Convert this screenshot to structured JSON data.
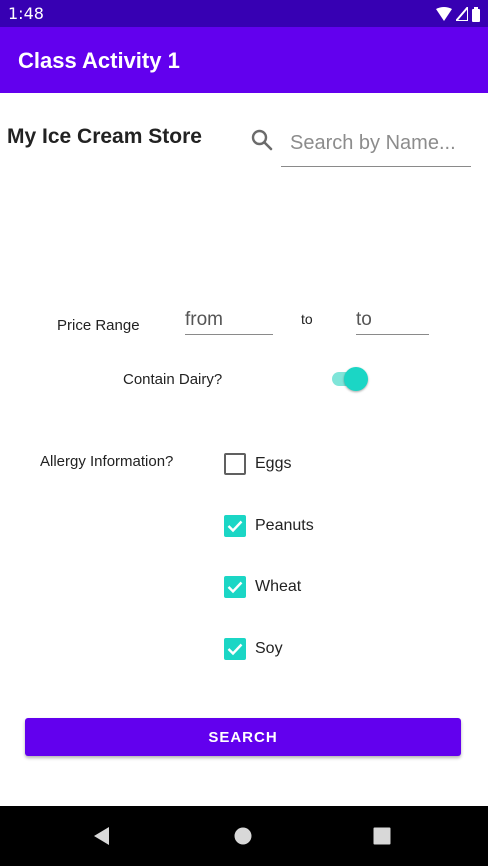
{
  "status_bar": {
    "time": "1:48",
    "icons": [
      "wifi-icon",
      "signal-icon",
      "battery-icon"
    ]
  },
  "app_bar": {
    "title": "Class Activity 1"
  },
  "header": {
    "store_title": "My Ice Cream Store",
    "search_placeholder": "Search by Name...",
    "search_icon": "search-icon"
  },
  "filters": {
    "price_range_label": "Price Range",
    "from_placeholder": "from",
    "to_label": "to",
    "to_placeholder": "to",
    "dairy_label": "Contain Dairy?",
    "dairy_on": true,
    "allergy_label": "Allergy Information?",
    "allergies": [
      {
        "label": "Eggs",
        "checked": false
      },
      {
        "label": "Peanuts",
        "checked": true
      },
      {
        "label": "Wheat",
        "checked": true
      },
      {
        "label": "Soy",
        "checked": true
      }
    ]
  },
  "search_button": {
    "label": "SEARCH"
  },
  "nav": {
    "buttons": [
      "back-icon",
      "home-icon",
      "recents-icon"
    ]
  },
  "colors": {
    "primary": "#6200ee",
    "primary_dark": "#3700b3",
    "accent": "#1bd6c5"
  }
}
